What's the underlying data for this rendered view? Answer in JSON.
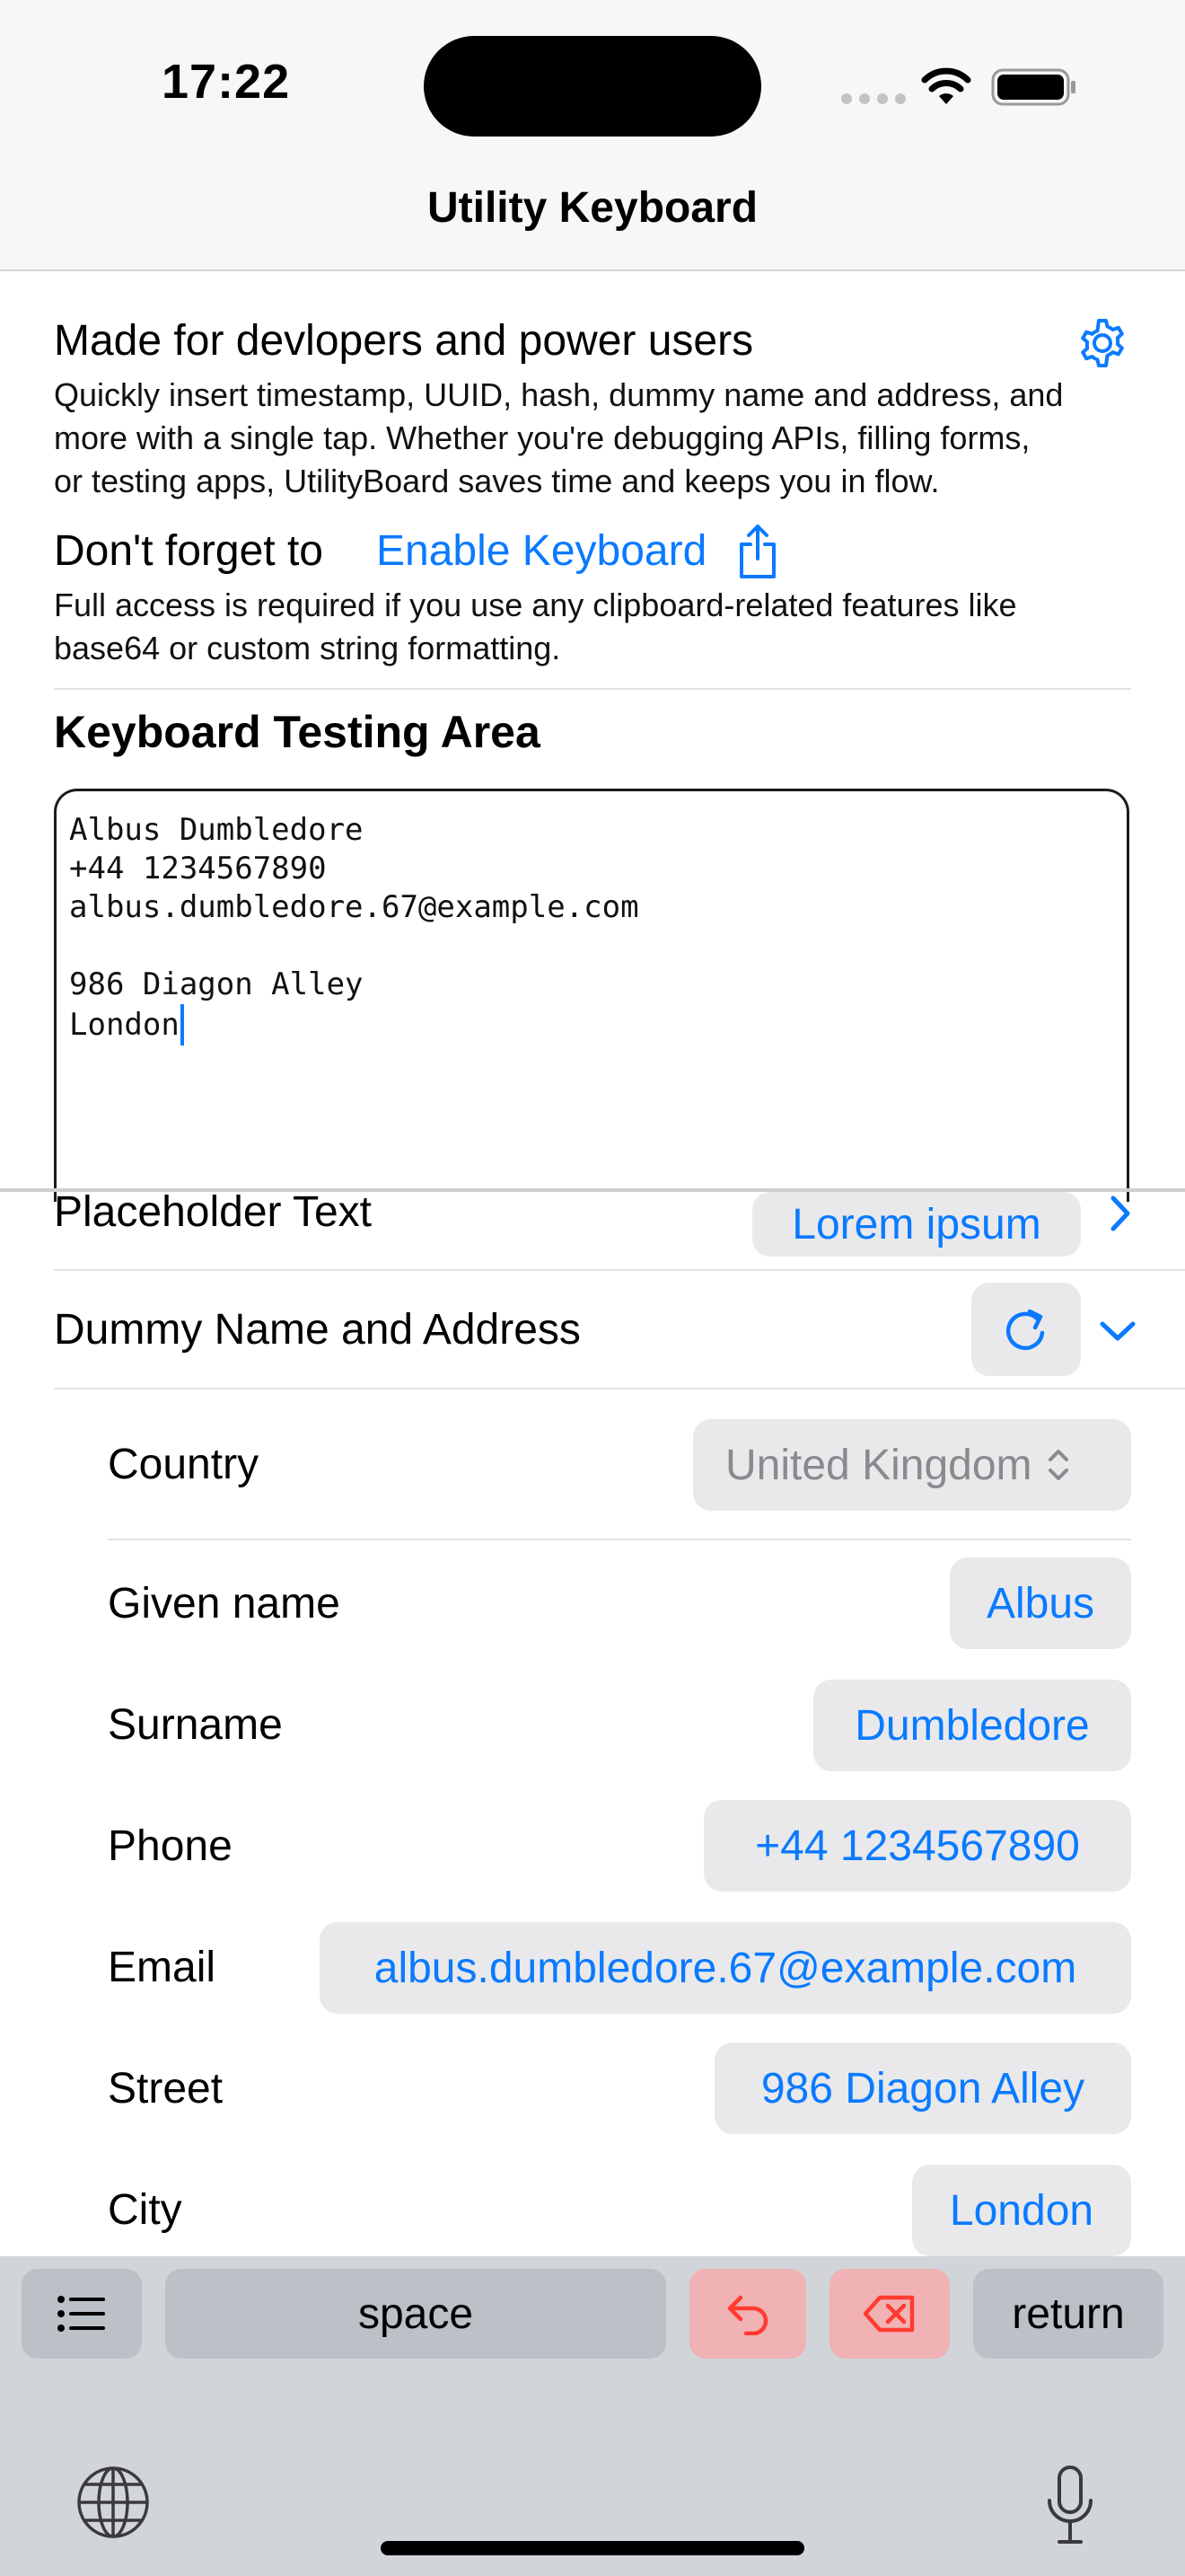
{
  "status_bar": {
    "time": "17:22"
  },
  "nav": {
    "title": "Utility Keyboard"
  },
  "intro": {
    "heading": "Made for devlopers and power users",
    "desc_lines": [
      "Quickly insert timestamp, UUID, hash, dummy name and address, and",
      "more with a single tap. Whether you're debugging APIs, filling forms,",
      "or testing apps, UtilityBoard saves time and keeps you in flow."
    ],
    "reminder_prefix": "Don't forget to",
    "enable_link": "Enable Keyboard",
    "note_lines": [
      "Full access is required if you use any clipboard-related features like",
      "base64 or custom string formatting."
    ]
  },
  "testing_area": {
    "title": "Keyboard Testing Area",
    "content": "Albus Dumbledore\n+44 1234567890\nalbus.dumbledore.67@example.com\n\n986 Diagon Alley\nLondon"
  },
  "rows": {
    "placeholder_label": "Placeholder Text",
    "placeholder_value": "Lorem ipsum",
    "dummy_label": "Dummy Name and Address"
  },
  "fields": {
    "country_label": "Country",
    "country_value": "United Kingdom",
    "given_label": "Given name",
    "given_value": "Albus",
    "surname_label": "Surname",
    "surname_value": "Dumbledore",
    "phone_label": "Phone",
    "phone_value": "+44 1234567890",
    "email_label": "Email",
    "email_value": "albus.dumbledore.67@example.com",
    "street_label": "Street",
    "street_value": "986 Diagon Alley",
    "city_label": "City",
    "city_value": "London"
  },
  "keyboard": {
    "space_label": "space",
    "return_label": "return"
  },
  "colors": {
    "accent": "#0a7aff",
    "destructive": "#ff3b30"
  }
}
